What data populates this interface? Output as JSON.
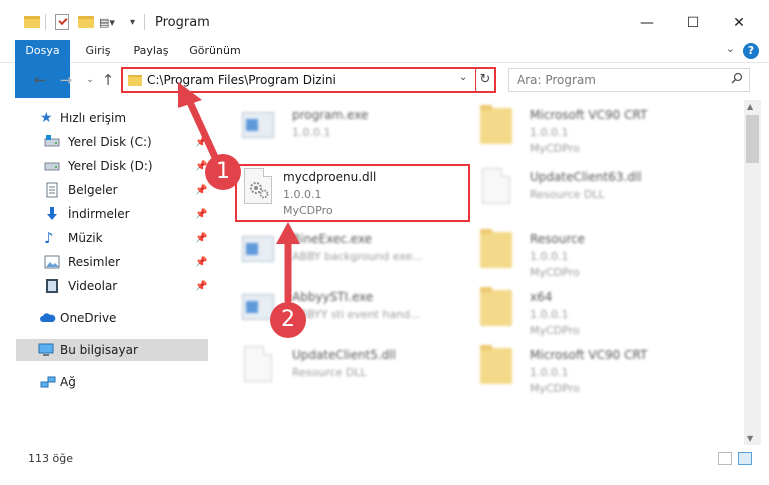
{
  "window": {
    "title": "Program",
    "minimize": "—",
    "maximize": "☐",
    "close": "✕"
  },
  "ribbon": {
    "tabs": [
      "Dosya",
      "Giriş",
      "Paylaş",
      "Görünüm"
    ],
    "help": "?"
  },
  "address": {
    "path": "C:\\Program Files\\Program Dizini",
    "search_placeholder": "Ara: Program"
  },
  "nav": {
    "quick_access": "Hızlı erişim",
    "items": [
      {
        "label": "Yerel Disk (C:)",
        "icon": "drive-icon"
      },
      {
        "label": "Yerel Disk (D:)",
        "icon": "drive-icon"
      },
      {
        "label": "Belgeler",
        "icon": "documents-icon"
      },
      {
        "label": "İndirmeler",
        "icon": "download-icon"
      },
      {
        "label": "Müzik",
        "icon": "music-icon"
      },
      {
        "label": "Resimler",
        "icon": "pictures-icon"
      },
      {
        "label": "Videolar",
        "icon": "videos-icon"
      }
    ],
    "onedrive": "OneDrive",
    "this_pc": "Bu bilgisayar",
    "network": "Ağ"
  },
  "files": [
    {
      "name": "program.exe",
      "l2": "1.0.0.1",
      "l3": "MyCDPro"
    },
    {
      "name": "Microsoft VC90 CRT",
      "l2": "1.0.0.1",
      "l3": "MyCDPro"
    },
    {
      "name": "mycdproenu.dll",
      "l2": "1.0.0.1",
      "l3": "MyCDPro"
    },
    {
      "name": "UpdateClient63.dll",
      "l2": "Resource DLL",
      "l3": ""
    },
    {
      "name": "BineExec.exe",
      "l2": "ABBY background exe...",
      "l3": ""
    },
    {
      "name": "Resource",
      "l2": "1.0.0.1",
      "l3": "MyCDPro"
    },
    {
      "name": "AbbyySTI.exe",
      "l2": "ABBYY sti event hand...",
      "l3": ""
    },
    {
      "name": "x64",
      "l2": "1.0.0.1",
      "l3": "MyCDPro"
    },
    {
      "name": "UpdateClient5.dll",
      "l2": "Resource DLL",
      "l3": ""
    },
    {
      "name": "Microsoft VC90 CRT",
      "l2": "1.0.0.1",
      "l3": "MyCDPro"
    }
  ],
  "status": {
    "count": "113 öğe"
  },
  "markers": [
    "1",
    "2"
  ],
  "colors": {
    "accent": "#1979ca",
    "highlight": "#e8353a",
    "marker": "#e2434a"
  }
}
